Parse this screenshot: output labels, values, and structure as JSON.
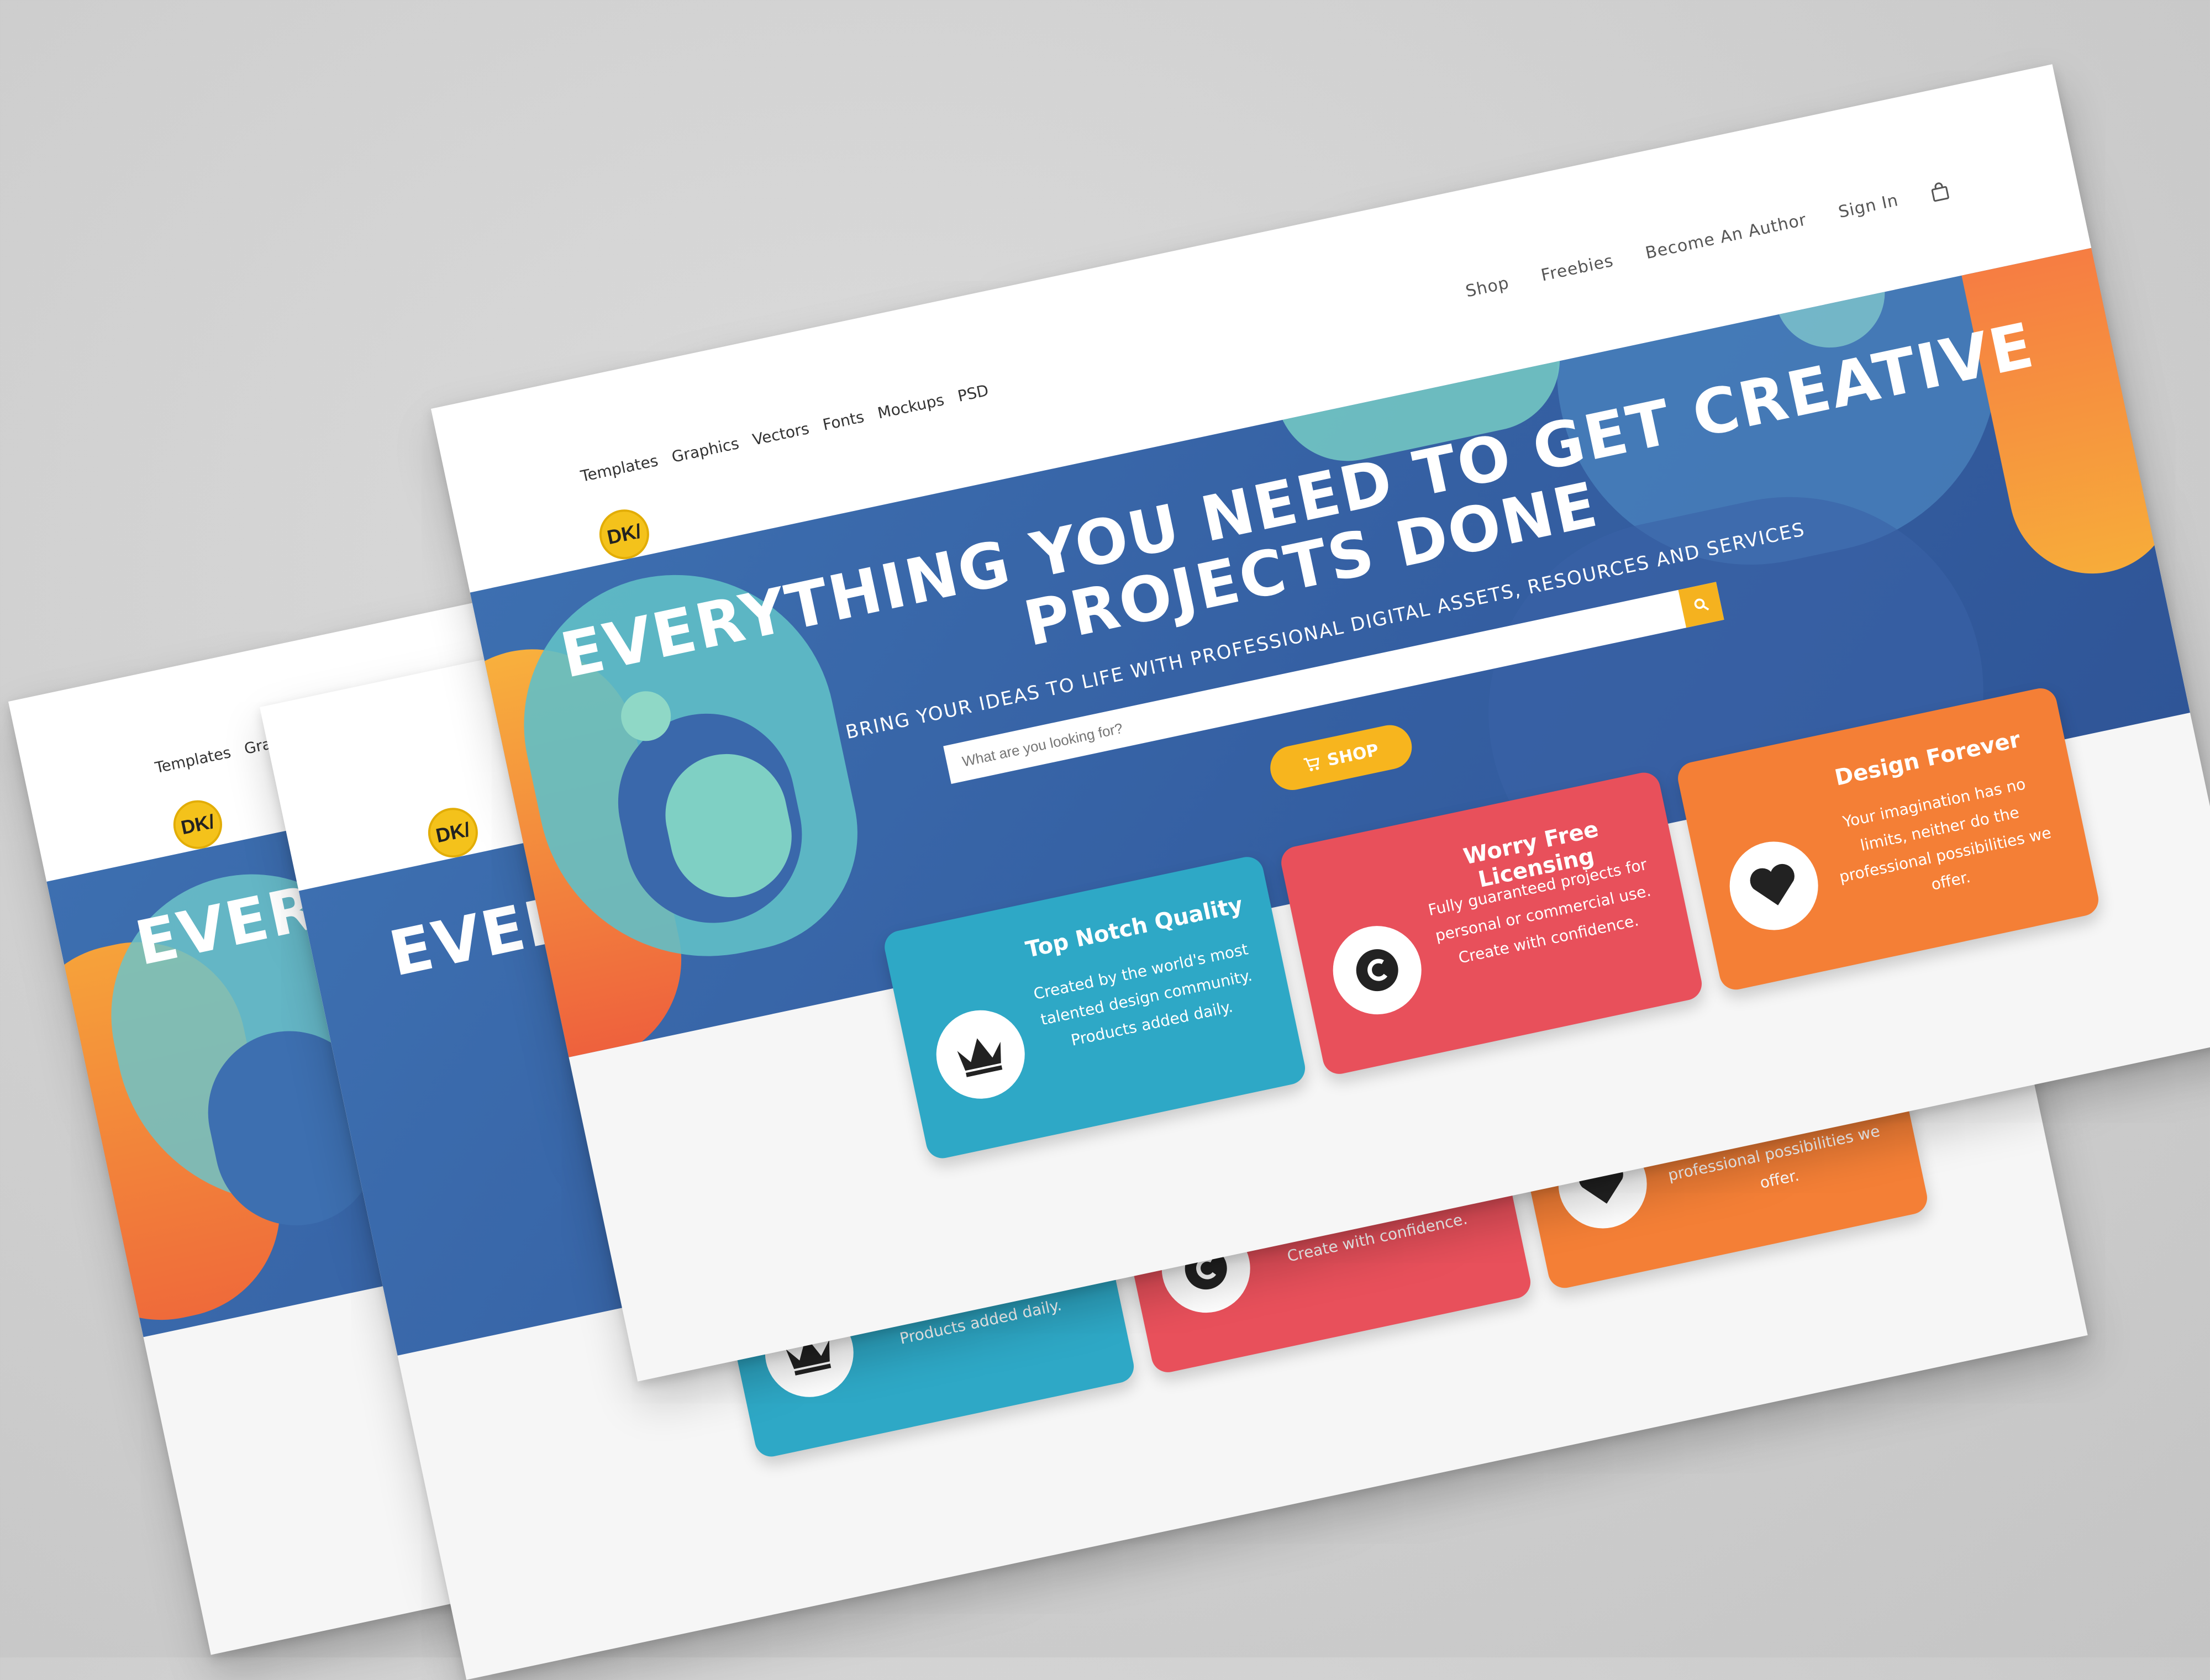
{
  "site": {
    "logo_text": "DK/",
    "category_nav": [
      "Templates",
      "Graphics",
      "Vectors",
      "Fonts",
      "Mockups",
      "PSD"
    ],
    "top_nav": [
      "Shop",
      "Freebies",
      "Become An Author",
      "Sign In"
    ]
  },
  "hero": {
    "title_line1": "EVERYTHING YOU NEED TO GET CREATIVE",
    "title_line2": "PROJECTS DONE",
    "subtitle": "BRING YOUR IDEAS TO LIFE WITH PROFESSIONAL DIGITAL ASSETS, RESOURCES AND SERVICES",
    "search_placeholder": "What are you looking for?",
    "shop_label": "SHOP"
  },
  "features": [
    {
      "title": "Top Notch Quality",
      "desc": "Created by the world's most talented design community. Products added daily.",
      "color": "#2ea8c6",
      "icon": "crown-icon"
    },
    {
      "title": "Worry Free Licensing",
      "desc": "Fully guaranteed projects for personal or commercial use. Create with confidence.",
      "color": "#e8505b",
      "icon": "copyright-icon"
    },
    {
      "title": "Design Forever",
      "desc": "Your imagination has no limits, neither do the professional possibilities we offer.",
      "color": "#f47f36",
      "icon": "heart-icon"
    }
  ],
  "colors": {
    "hero_blue": "#3560a3",
    "accent_yellow": "#f5b21f",
    "teal": "#2ea8c6",
    "red": "#e8505b",
    "orange": "#f47f36"
  }
}
